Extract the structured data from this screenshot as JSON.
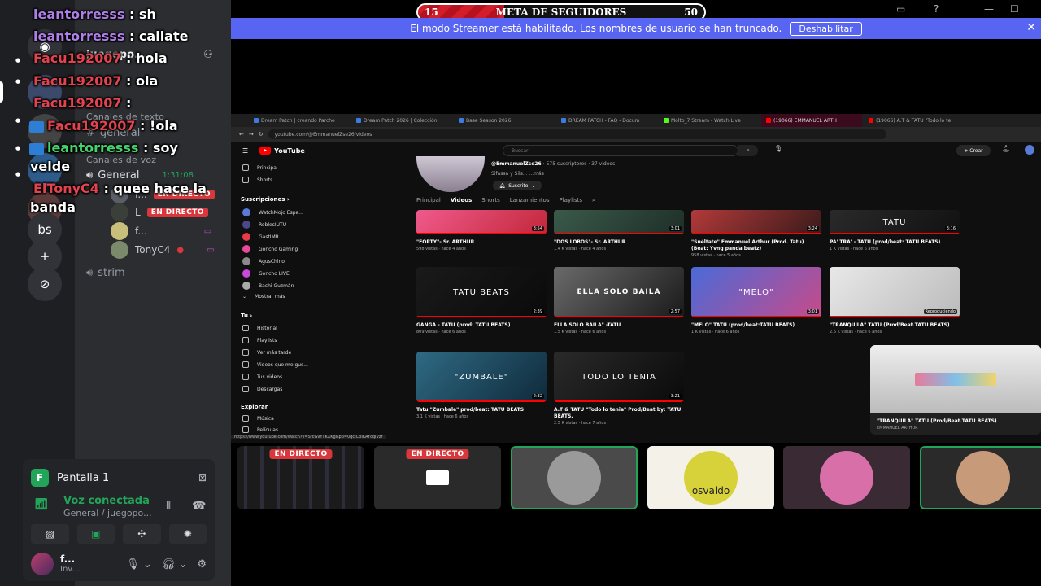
{
  "goal": {
    "current": "15",
    "target": "50",
    "title": "META DE SEGUIDORES",
    "progress_fraction": 0.3
  },
  "streamer_mode": {
    "message": "El modo Streamer está habilitado. Los nombres de usuario se han truncado.",
    "disable_label": "Deshabilitar"
  },
  "chat": [
    {
      "user": "leantorresss",
      "text": ": sh",
      "color": "purple"
    },
    {
      "user": "leantorresss",
      "text": ": callate",
      "color": "purple"
    },
    {
      "user": "Facu192007",
      "text": ": hola",
      "color": "red"
    },
    {
      "user": "Facu192007",
      "text": ": ola",
      "color": "red"
    },
    {
      "user": "Facu192007",
      "text": ":",
      "color": "red"
    },
    {
      "user": "Facu192007",
      "text": ": !ola",
      "color": "red"
    },
    {
      "user": "leantorresss",
      "text": ": soy",
      "color": "green"
    },
    {
      "user": "",
      "text": "velde",
      "color": "green"
    },
    {
      "user": "ElTonyC4",
      "text": ": quee hace la",
      "color": "red"
    },
    {
      "user": "",
      "text": "banda",
      "color": "red"
    }
  ],
  "server_rail": {
    "items": [
      {
        "label": "bs"
      },
      {
        "label": "+"
      },
      {
        "label": "⊘"
      }
    ]
  },
  "channels": {
    "server_name": "juegopo...",
    "text_category": "Canales de texto",
    "text_channel": "general",
    "voice_category": "Canales de voz",
    "voice_channel": "General",
    "voice_time": "1:31:08",
    "voice_users": [
      {
        "name": "f...",
        "live": "EN DIRECTO"
      },
      {
        "name": "L",
        "live": "EN DIRECTO"
      },
      {
        "name": "f...",
        "live": ""
      },
      {
        "name": "TonyC4",
        "live": ""
      }
    ],
    "other_voice": "strim"
  },
  "voice_panel": {
    "screen_share": "Pantalla 1",
    "status": "Voz conectada",
    "location": "General / juegopo...",
    "user_name": "f...",
    "user_status": "Inv..."
  },
  "browser": {
    "tabs": [
      "Dream Patch | creando Parche",
      "Dream Patch 2026 | Colección",
      "Base Season 2026",
      "DREAM PATCH - FAQ - Docum",
      "Molto_7 Stream - Watch Live",
      "(19066) EMMANUEL ARTH",
      "(19066) A.T & TATU \"Todo lo te"
    ],
    "url": "youtube.com/@EmmanuelZse26/videos",
    "logo": "YouTube",
    "search_placeholder": "Buscar",
    "create_label": "+ Crear",
    "sidebar_main": [
      "Principal",
      "Shorts"
    ],
    "subs_header": "Suscripciones  ›",
    "subscriptions": [
      "WatchMojo Espa...",
      "RoblesIUTU",
      "GastIMR",
      "Goncho Gaming",
      "AgusChino",
      "Goncho LIVE",
      "Bachi Guzmán",
      "Mostrar más"
    ],
    "you_header": "Tú  ›",
    "you_items": [
      "Historial",
      "Playlists",
      "Ver más tarde",
      "Videos que me gus...",
      "Tus videos",
      "Descargas"
    ],
    "explore_header": "Explorar",
    "explore_items": [
      "Música",
      "Películas"
    ],
    "channel_handle": "@EmmanuelZse26",
    "channel_desc": "Sifassa y Sils...  ...más",
    "channel_stats": "· 575 suscriptores · 37 videos",
    "subscribed_label": "Suscrito",
    "channel_tabs": [
      "Principal",
      "Videos",
      "Shorts",
      "Lanzamientos",
      "Playlists"
    ],
    "videos": [
      {
        "title": "\"FORTY\"- Sr. ARTHUR",
        "meta": "598 vistas · hace 4 años",
        "dur": "3:54",
        "thumb": "",
        "colors": [
          "#f05a8c",
          "#c2283a"
        ]
      },
      {
        "title": "\"DOS LOBOS\"- Sr. ARTHUR",
        "meta": "1.4 K vistas · hace 4 años",
        "dur": "3:01",
        "thumb": "",
        "colors": [
          "#3a5a4a",
          "#1e2e28"
        ]
      },
      {
        "title": "\"Suéltate\" Emmanuel Arthur (Prod. Tatu) (Beat: Yvng panda beatz)",
        "meta": "958 vistas · hace 5 años",
        "dur": "3:24",
        "thumb": "",
        "colors": [
          "#b23a3a",
          "#3a1a1a"
        ]
      },
      {
        "title": "PA' TRA' - TATU (prod/beat: TATU BEATS)",
        "meta": "1 K vistas · hace 6 años",
        "dur": "3:16",
        "thumb": "TATU",
        "colors": [
          "#2a2a2a",
          "#111111"
        ]
      },
      {
        "title": "GANGA - TATU (prod: TATU BEATS)",
        "meta": "809 vistas · hace 6 años",
        "dur": "2:39",
        "thumb": "TATU BEATS",
        "colors": [
          "#1a1a1a",
          "#0a0a0a"
        ]
      },
      {
        "title": "ELLA SOLO BAILA\" -TATU",
        "meta": "1.5 K vistas · hace 6 años",
        "dur": "2:57",
        "thumb": "ELLA SOLO BAILA",
        "colors": [
          "#6a6a6a",
          "#1a1a1a"
        ]
      },
      {
        "title": "\"MELO\" TATU (prod/beat:TATU BEATS)",
        "meta": "1 K vistas · hace 6 años",
        "dur": "3:01",
        "thumb": "\"MELO\"",
        "colors": [
          "#4a6ad8",
          "#c84a8a"
        ]
      },
      {
        "title": "\"TRANQUILA\" TATU (Prod/Beat.TATU BEATS)",
        "meta": "2.6 K vistas · hace 6 años",
        "dur": "Reproduciendo",
        "thumb": "",
        "colors": [
          "#e8e8e8",
          "#bbbbbb"
        ]
      },
      {
        "title": "Tatu \"Zumbale\" prod/beat: TATU BEATS",
        "meta": "3.1 K vistas · hace 6 años",
        "dur": "2:32",
        "thumb": "\"ZUMBALE\"",
        "colors": [
          "#2f6a84",
          "#0f2a3a"
        ]
      },
      {
        "title": "A.T & TATU \"Todo lo tenia\" Prod/Beat by: TATU BEATS.",
        "meta": "2.5 K vistas · hace 7 años",
        "dur": "3:21",
        "thumb": "TODO LO TENIA",
        "colors": [
          "#2a2a2a",
          "#0a0a0a"
        ]
      }
    ],
    "hover_card": {
      "title": "\"TRANQUILA\" TATU (Prod/Beat.TATU BEATS)",
      "channel": "EMMANUEL ARTHUR"
    },
    "status_url": "https://www.youtube.com/watch?v=SrcGvYTKXKg&pp=0gcJCbIKAYcqIVzr"
  },
  "participants": [
    {
      "live": "EN DIRECTO",
      "label": "",
      "speaking": false,
      "color": "#1b1b1b"
    },
    {
      "live": "EN DIRECTO",
      "label": "",
      "speaking": false,
      "color": "#2a2a2a"
    },
    {
      "live": "",
      "label": "",
      "speaking": true,
      "color": "#4a4a4a"
    },
    {
      "live": "",
      "label": "osvaldo",
      "speaking": false,
      "color": "#f3f1e8"
    },
    {
      "live": "",
      "label": "",
      "speaking": false,
      "color": "#3a2a34"
    },
    {
      "live": "",
      "label": "",
      "speaking": true,
      "color": "#2a2a2a"
    }
  ]
}
